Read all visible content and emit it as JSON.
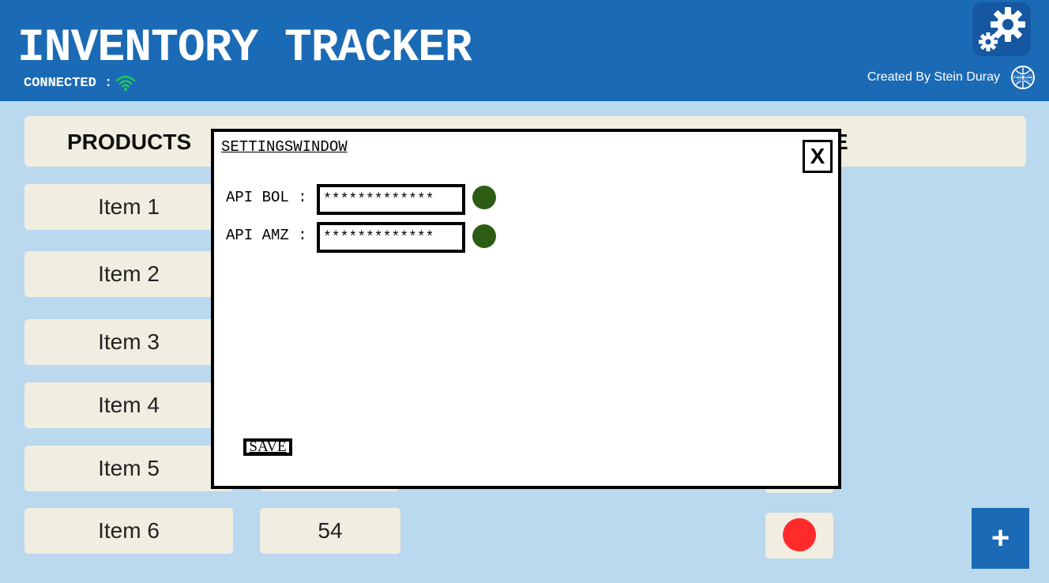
{
  "header": {
    "title": "INVENTORY TRACKER",
    "connection_label": "CONNECTED :",
    "credit": "Created By Stein Duray",
    "settings_icon": "gears-icon",
    "connection_icon": "wifi-icon",
    "logo_text": "SDD"
  },
  "colors": {
    "header_bg": "#1b6ab5",
    "page_bg": "#bad8ee",
    "cell_bg": "#f1ede1",
    "status_ok": "#2d5d14",
    "status_alert": "#ff2b2b",
    "wifi": "#22c55e"
  },
  "table": {
    "column_header": "PRODUCTS",
    "partial_header_letter": "E",
    "rows": [
      {
        "name": "Item 1"
      },
      {
        "name": "Item 2"
      },
      {
        "name": "Item 3"
      },
      {
        "name": "Item 4"
      },
      {
        "name": "Item 5"
      },
      {
        "name": "Item 6",
        "quantity": "54",
        "status": "red"
      }
    ]
  },
  "add_button_label": "+",
  "settings_window": {
    "title": "SETTINGSWINDOW",
    "close_label": "X",
    "fields": [
      {
        "label": "API BOL :",
        "value": "*************",
        "status": "green"
      },
      {
        "label": "API AMZ :",
        "value": "*************",
        "status": "green"
      }
    ],
    "save_label": "SAVE"
  }
}
